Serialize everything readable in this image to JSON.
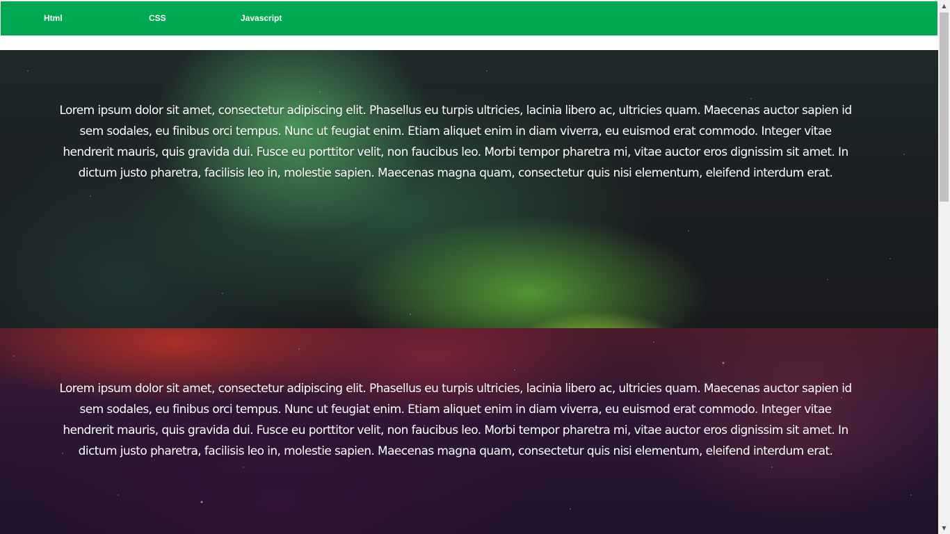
{
  "nav": {
    "items": [
      {
        "label": "Html"
      },
      {
        "label": "CSS"
      },
      {
        "label": "Javascript"
      }
    ]
  },
  "sections": [
    {
      "background": "aurora-night-sky",
      "text": "Lorem ipsum dolor sit amet, consectetur adipiscing elit. Phasellus eu turpis ultricies, lacinia libero ac, ultricies quam. Maecenas auctor sapien id sem sodales, eu finibus orci tempus. Nunc ut feugiat enim. Etiam aliquet enim in diam viverra, eu euismod erat commodo. Integer vitae hendrerit mauris, quis gravida dui. Fusce eu porttitor velit, non faucibus leo. Morbi tempor pharetra mi, vitae auctor eros dignissim sit amet. In dictum justo pharetra, facilisis leo in, molestie sapien. Maecenas magna quam, consectetur quis nisi elementum, eleifend interdum erat."
    },
    {
      "background": "red-purple-nebula",
      "text": "Lorem ipsum dolor sit amet, consectetur adipiscing elit. Phasellus eu turpis ultricies, lacinia libero ac, ultricies quam. Maecenas auctor sapien id sem sodales, eu finibus orci tempus. Nunc ut feugiat enim. Etiam aliquet enim in diam viverra, eu euismod erat commodo. Integer vitae hendrerit mauris, quis gravida dui. Fusce eu porttitor velit, non faucibus leo. Morbi tempor pharetra mi, vitae auctor eros dignissim sit amet. In dictum justo pharetra, facilisis leo in, molestie sapien. Maecenas magna quam, consectetur quis nisi elementum, eleifend interdum erat."
    }
  ],
  "colors": {
    "navbar": "#00a851",
    "nav_text": "#ffffff",
    "section_text": "#ffffff"
  },
  "scrollbar": {
    "up_icon": "triangle-up",
    "down_icon": "triangle-down"
  }
}
